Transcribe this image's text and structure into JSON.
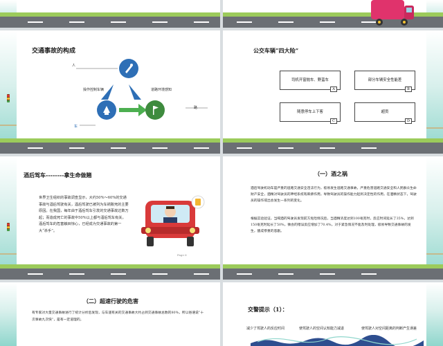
{
  "slide3": {
    "title": "交通事故的构成",
    "label_person": "人",
    "label_car": "车",
    "label_road": "路",
    "label_operate": "操作控制车辆",
    "label_env": "道路环境感知"
  },
  "slide4": {
    "title": "公交车辆“四大险”",
    "boxes": [
      {
        "text": "司机开窗抛车、野蛮车",
        "letter": "A"
      },
      {
        "text": "部分车辆安全性能差",
        "letter": "B"
      },
      {
        "text": "随意停车上下客",
        "letter": "C"
      },
      {
        "text": "超员",
        "letter": "D"
      }
    ]
  },
  "slide5": {
    "title": "酒后驾车--------拿生命做赌",
    "body": "世界卫生组织的事故调查显示，大约50%～60%的交通事故与酒后驾驶有关，酒后驾驶已被列为车祸致死的主要原因。在我国，每年由于酒后驾车引发的交通事故达数万起；而造成死亡的事故中50%以上都与酒后驾车有关，酒后驾车的危害触目惊心，已经成为交通事故的第一大“杀手”。",
    "page": "Page 6"
  },
  "slide6": {
    "title": "（一）酒之祸",
    "para1": "酒后驾驶机动车是严重的道路交通安全违法行为，极易发生道路交通事故，严重危害道路交通安全和人民群众生命财产安全，酒精对驾驶员的神经系统有麻痹作用，导致驾驶员的操作能力起到决定性的作用，在酒精状态下，驾驶员的操作或出会发生一系列的变化。",
    "para2": "根据实验验证，当喝酒的驾驶员发现前方危险情况后，当酒精浓度达到100毫克时，反应时间延长了35%，达到150毫克时延长了50%，微会的错误反应增加了70.4%，对于紧急情况不能及时处理，极易导致交通事故的发生，酿成惨重的悲剧。"
  },
  "slide7": {
    "title": "（二）超速行驶的危害",
    "body": "有专家对大量交通事故进行了统计分析后发现，与车速有关的交通事故大约占到交通事故总数的80%，所以俗语说“十次事故九次快”，是有一定道理的。"
  },
  "slide8": {
    "title": "交警提示（1）：",
    "items": [
      "减少了驾驶人的反应时间",
      "使驾驶人的空间认知能力减退",
      "使驾驶人对空间距离的判断产生误差"
    ]
  },
  "colors": {
    "blue": "#2e6fb6",
    "green": "#3e8b3e",
    "accent_green": "#4caf50",
    "teal": "#8fd6cc"
  }
}
